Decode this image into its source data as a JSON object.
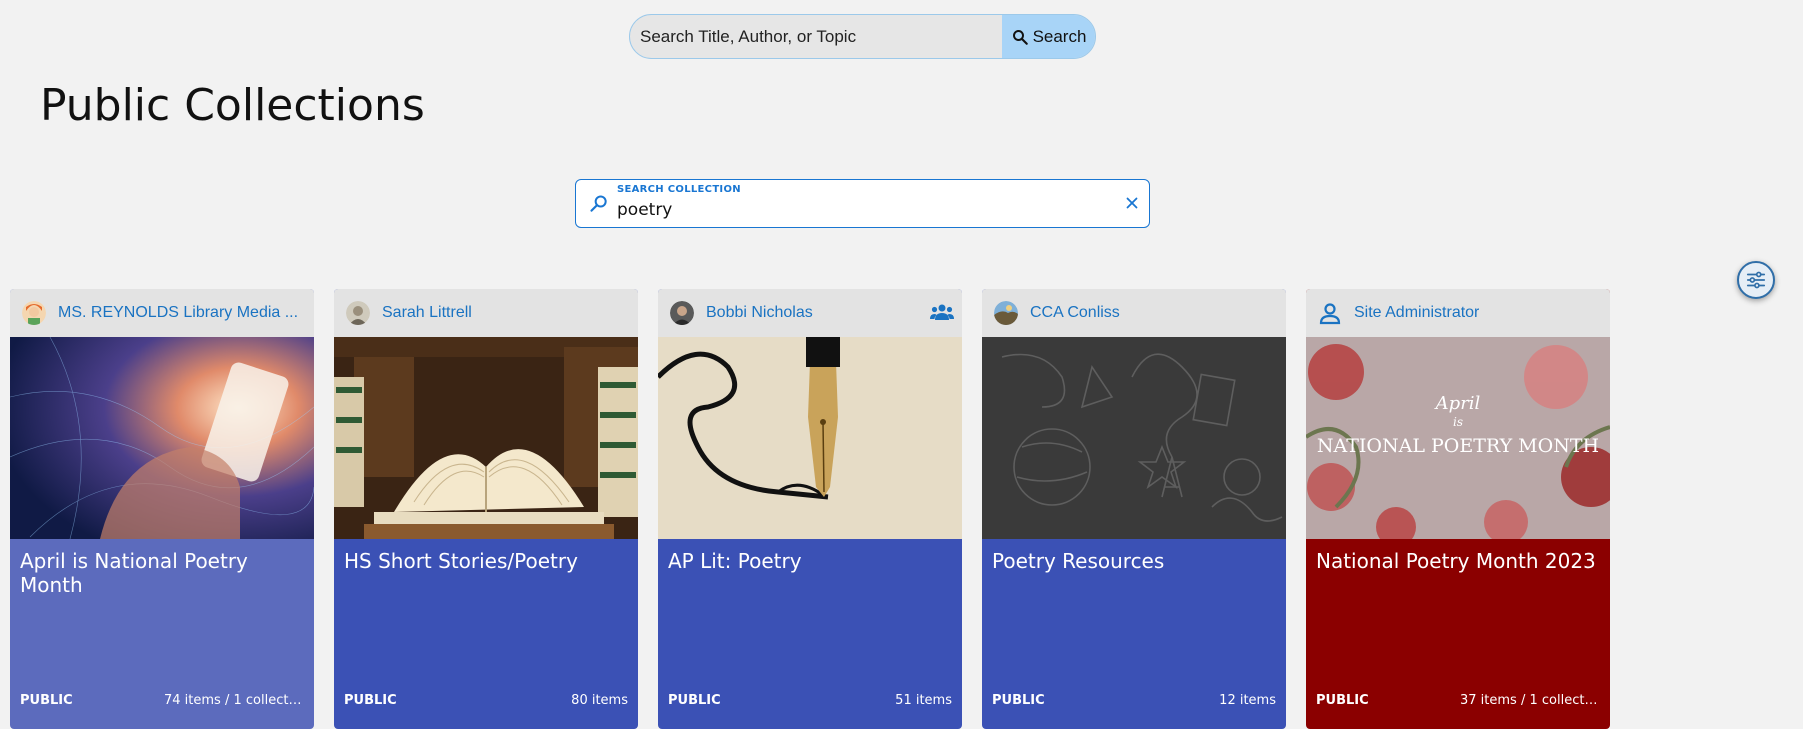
{
  "top_search": {
    "placeholder": "Search Title, Author, or Topic",
    "button_label": "Search"
  },
  "page_title": "Public Collections",
  "collection_search": {
    "label": "SEARCH COLLECTION",
    "value": "poetry"
  },
  "colors": {
    "accent": "#1976d2",
    "card_blue": "#3b51b5",
    "card_light_blue": "#5c6bbd",
    "card_red": "#8b0000",
    "owner_link": "#1a73c2"
  },
  "cards": [
    {
      "owner": "MS. REYNOLDS Library Media ...",
      "title": "April is National Poetry Month",
      "visibility": "PUBLIC",
      "count": "74 items / 1 collecti...",
      "image": "digital-hand-phone"
    },
    {
      "owner": "Sarah Littrell",
      "title": "HS Short Stories/Poetry",
      "visibility": "PUBLIC",
      "count": "80 items",
      "image": "open-book-stacks"
    },
    {
      "owner": "Bobbi Nicholas",
      "title": "AP Lit: Poetry",
      "visibility": "PUBLIC",
      "count": "51 items",
      "image": "fountain-pen-ink",
      "icon": "group-icon"
    },
    {
      "owner": "CCA Conliss",
      "title": "Poetry Resources",
      "visibility": "PUBLIC",
      "count": "12 items",
      "image": "chalkboard-doodles"
    },
    {
      "owner": "Site Administrator",
      "title": "National Poetry Month 2023",
      "visibility": "PUBLIC",
      "count": "37 items / 1 collecti...",
      "image": "roses-poster",
      "image_text": [
        "April",
        "is",
        "NATIONAL POETRY MONTH"
      ]
    }
  ]
}
